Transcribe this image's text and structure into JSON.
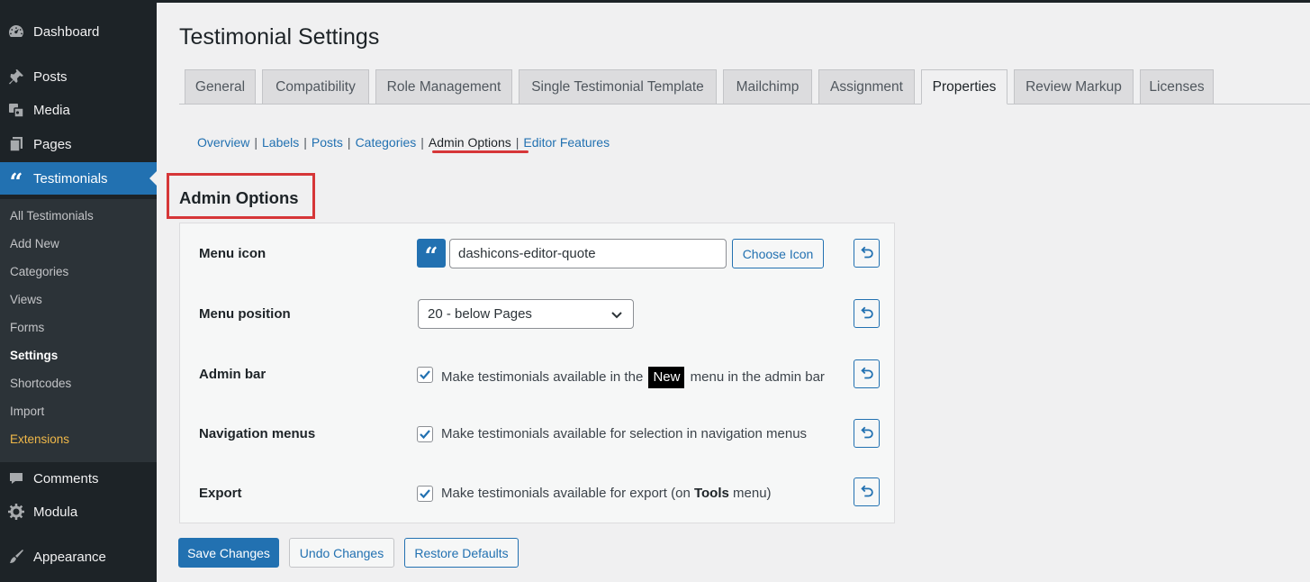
{
  "sidebar": {
    "menu": [
      {
        "label": "Dashboard",
        "icon": "dashboard-icon"
      },
      {
        "label": "Posts",
        "icon": "pin-icon"
      },
      {
        "label": "Media",
        "icon": "media-icon"
      },
      {
        "label": "Pages",
        "icon": "pages-icon"
      },
      {
        "label": "Testimonials",
        "icon": "quote-icon"
      },
      {
        "label": "Comments",
        "icon": "comment-icon"
      },
      {
        "label": "Modula",
        "icon": "gear-icon"
      },
      {
        "label": "Appearance",
        "icon": "brush-icon"
      }
    ],
    "submenu": [
      "All Testimonials",
      "Add New",
      "Categories",
      "Views",
      "Forms",
      "Settings",
      "Shortcodes",
      "Import",
      "Extensions"
    ]
  },
  "page": {
    "title": "Testimonial Settings"
  },
  "tabs": [
    "General",
    "Compatibility",
    "Role Management",
    "Single Testimonial Template",
    "Mailchimp",
    "Assignment",
    "Properties",
    "Review Markup",
    "Licenses"
  ],
  "active_tab": "Properties",
  "subnav": {
    "links": [
      "Overview",
      "Labels",
      "Posts",
      "Categories",
      "Admin Options",
      "Editor Features"
    ],
    "current": "Admin Options"
  },
  "section": {
    "title": "Admin Options"
  },
  "settings": {
    "menu_icon": {
      "label": "Menu icon",
      "value": "dashicons-editor-quote",
      "choose_label": "Choose Icon",
      "preview_glyph": "“"
    },
    "menu_position": {
      "label": "Menu position",
      "value": "20 - below Pages"
    },
    "admin_bar": {
      "label": "Admin bar",
      "text_before": "Make testimonials available in the",
      "badge": "New",
      "text_after": "menu in the admin bar",
      "checked": true
    },
    "nav_menus": {
      "label": "Navigation menus",
      "text": "Make testimonials available for selection in navigation menus",
      "checked": true
    },
    "export": {
      "label": "Export",
      "text_before": "Make testimonials available for export (on",
      "bold": "Tools",
      "text_after": "menu)",
      "checked": true
    }
  },
  "buttons": {
    "save": "Save Changes",
    "undo": "Undo Changes",
    "restore": "Restore Defaults"
  },
  "colors": {
    "accent": "#2271b1",
    "sidebar": "#1d2327",
    "highlight": "#d63638",
    "extensions": "#f0b849"
  }
}
